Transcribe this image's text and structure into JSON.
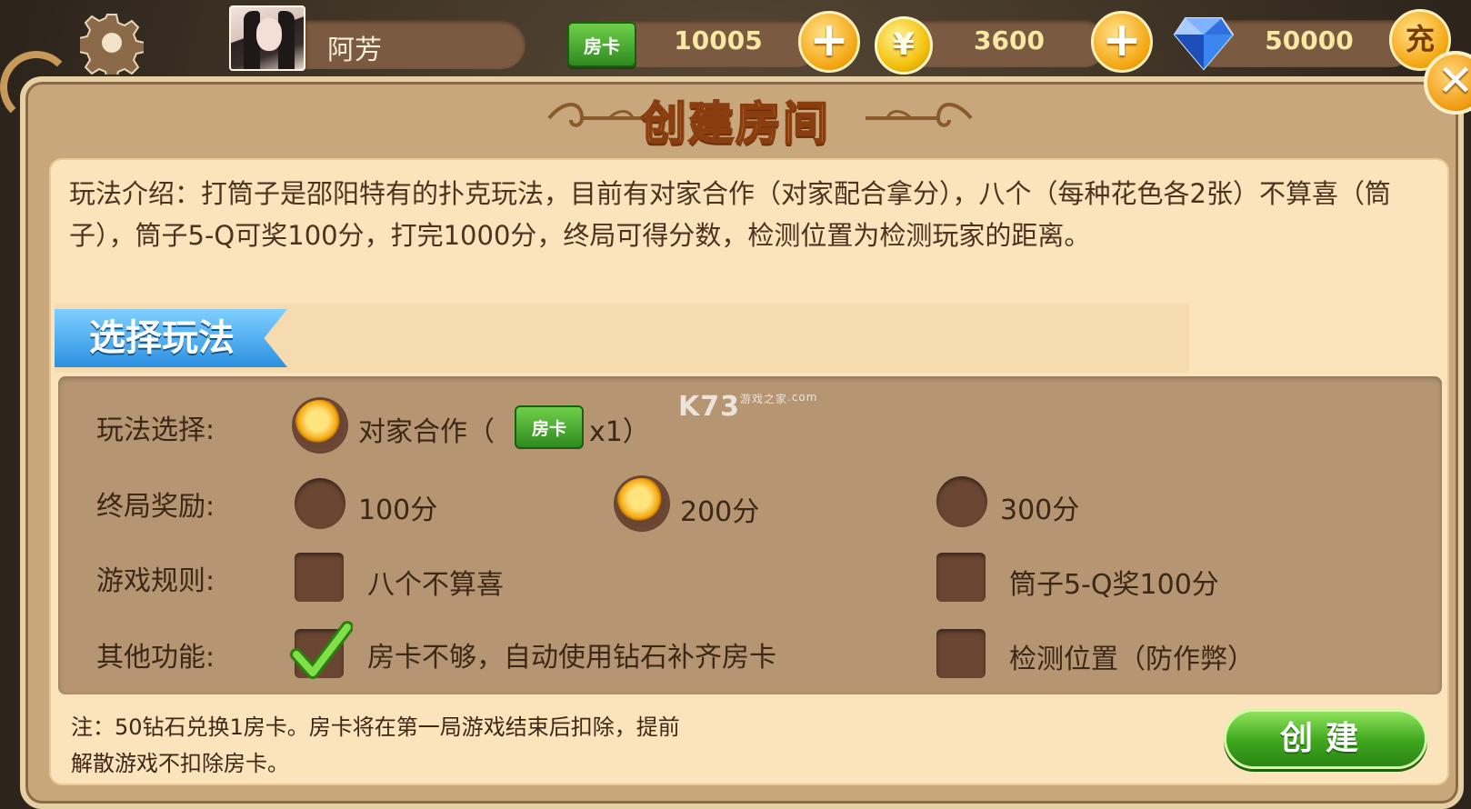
{
  "topbar": {
    "username": "阿芳",
    "room_card_badge": "房卡",
    "room_cards": "10005",
    "gold_symbol": "¥",
    "gold": "3600",
    "diamonds": "50000",
    "charge_label": "充",
    "plus_symbol": "+"
  },
  "dialog": {
    "title": "创建房间",
    "close_symbol": "✕",
    "intro": "玩法介绍：打筒子是邵阳特有的扑克玩法，目前有对家合作（对家配合拿分），八个（每种花色各2张）不算喜（筒子），筒子5-Q可奖100分，打完1000分，终局可得分数，检测位置为检测玩家的距离。",
    "section_title": "选择玩法",
    "rows": {
      "mode_label": "玩法选择:",
      "mode_option": "对家合作（",
      "mode_card": "房卡",
      "mode_suffix": "x1）",
      "reward_label": "终局奖励:",
      "reward_options": [
        "100分",
        "200分",
        "300分"
      ],
      "rules_label": "游戏规则:",
      "rules_options": [
        "八个不算喜",
        "筒子5-Q奖100分"
      ],
      "other_label": "其他功能:",
      "other_options": [
        "房卡不够，自动使用钻石补齐房卡",
        "检测位置（防作弊）"
      ]
    },
    "state": {
      "mode_selected": true,
      "reward_selected": "200分",
      "rules_checked": [
        false,
        false
      ],
      "other_checked": [
        true,
        false
      ]
    },
    "note_line1": "注：50钻石兑换1房卡。房卡将在第一局游戏结束后扣除，提前",
    "note_line2": "解散游戏不扣除房卡。",
    "create_label": "创建"
  },
  "watermark": {
    "main": "K73",
    "sub": "游戏之家",
    "sub2": ".com"
  },
  "colors": {
    "accent_orange": "#f3aa12",
    "panel_brown": "#b59572",
    "create_green": "#3ea51e",
    "tag_blue": "#2b8fe0"
  },
  "icons": [
    "gear-icon",
    "room-card-icon",
    "gold-coin-icon",
    "diamond-icon",
    "plus-icon",
    "close-icon",
    "check-icon"
  ]
}
